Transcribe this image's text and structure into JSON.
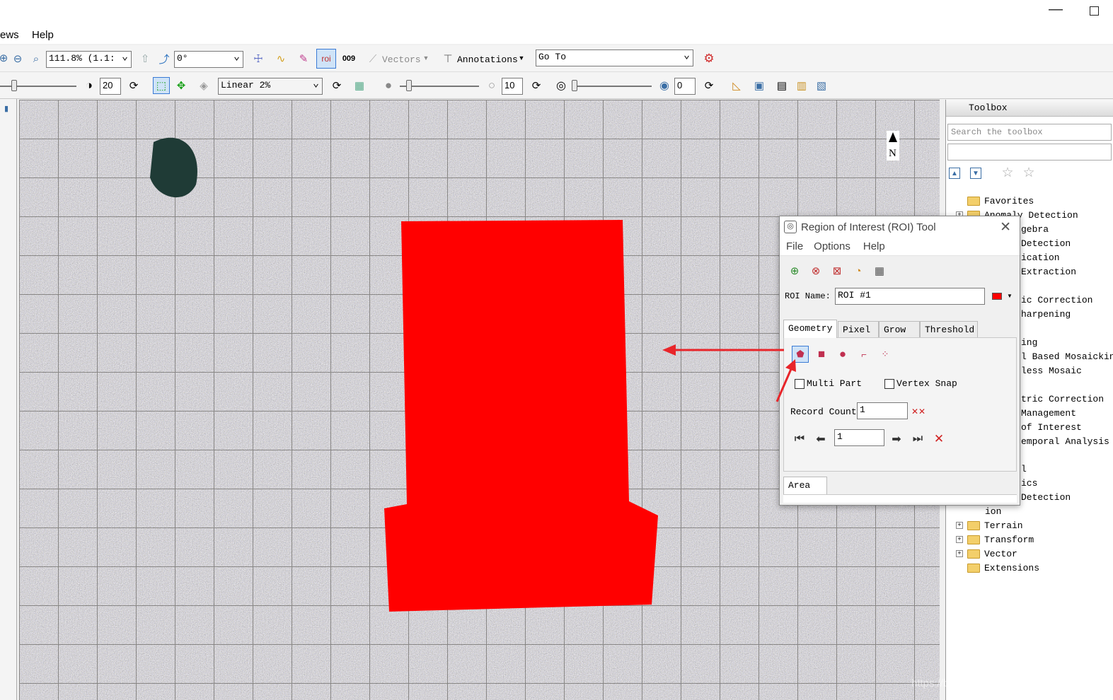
{
  "menu": {
    "views": "ews",
    "help": "Help"
  },
  "toolbar1": {
    "zoom_value": "111.8% (1.1:",
    "rotation_value": "0°",
    "vectors_label": "Vectors",
    "annotations_label": "Annotations",
    "goto_value": "Go To"
  },
  "toolbar2": {
    "brightness_value": "20",
    "stretch_value": "Linear 2%",
    "sharpen_value": "10",
    "transparency_value": "0"
  },
  "map": {
    "north_label": "N",
    "roi_color": "#ff0000"
  },
  "toolbox": {
    "title": "Toolbox",
    "search_placeholder": "Search the toolbox",
    "items": [
      {
        "label": "Favorites",
        "expand": false
      },
      {
        "label": "Anomaly Detection",
        "expand": true
      },
      {
        "label": "Terrain",
        "expand": true
      },
      {
        "label": "Transform",
        "expand": true
      },
      {
        "label": "Vector",
        "expand": true
      },
      {
        "label": "Extensions",
        "expand": false
      }
    ],
    "partial": [
      "gebra",
      "Detection",
      "ication",
      "Extraction",
      "ic Correction",
      "harpening",
      "ing",
      "l Based Mosaickin",
      "less Mosaic",
      "tric Correction",
      "Management",
      "of Interest",
      "emporal Analysis",
      "l",
      "ics",
      "Detection",
      "ion"
    ]
  },
  "roi_tool": {
    "title": "Region of Interest (ROI) Tool",
    "menu": {
      "file": "File",
      "options": "Options",
      "help": "Help"
    },
    "roi_name_label": "ROI Name:",
    "roi_name_value": "ROI #1",
    "roi_color": "#ff0000",
    "tabs": {
      "geometry": "Geometry",
      "pixel": "Pixel",
      "grow": "Grow",
      "threshold": "Threshold"
    },
    "multi_part_label": "Multi Part",
    "vertex_snap_label": "Vertex Snap",
    "record_count_label": "Record Count",
    "record_count_value": "1",
    "record_index_value": "1",
    "bottom_tab": "Area"
  },
  "watermark": "https://blog.csdn.net/weixin_39190382",
  "colors": {
    "arrow": "#e8252a",
    "roi": "#ff0000",
    "highlight": "#cfe3f7"
  }
}
